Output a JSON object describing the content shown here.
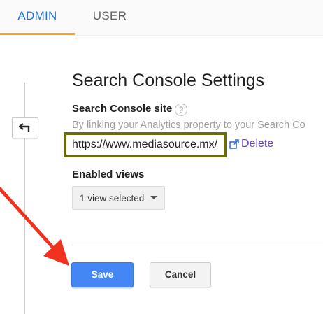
{
  "tabs": {
    "admin": "ADMIN",
    "user": "USER",
    "active": "ADMIN"
  },
  "settings": {
    "title": "Search Console Settings",
    "site_label": "Search Console site",
    "help_glyph": "?",
    "description": "By linking your Analytics property to your Search Co",
    "site_url": "https://www.mediasource.mx/",
    "delete_label": "Delete",
    "views_label": "Enabled views",
    "views_selected": "1 view selected"
  },
  "actions": {
    "save": "Save",
    "cancel": "Cancel"
  },
  "icons": {
    "back": "back-arrow-icon",
    "help": "help-icon",
    "external": "external-link-icon",
    "dropdown": "caret-down-icon"
  },
  "colors": {
    "accent_blue": "#1a73e8",
    "tab_underline": "#f4a81e",
    "save_button": "#4486f4",
    "highlight_border": "#6b6b12",
    "annotation_arrow": "#f0321e",
    "delete_link": "#6a3ec8"
  }
}
